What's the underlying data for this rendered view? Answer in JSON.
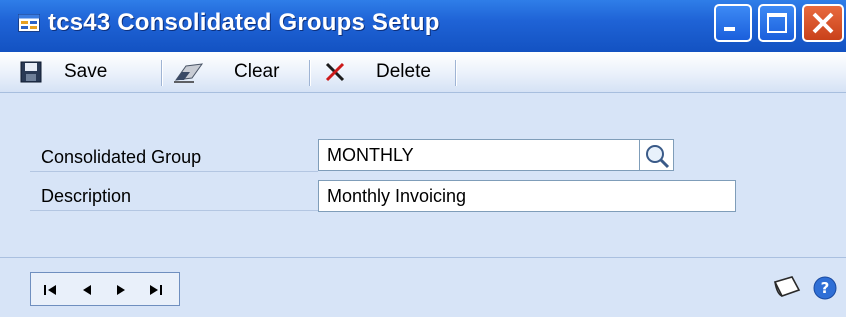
{
  "window": {
    "title": "tcs43 Consolidated Groups Setup",
    "icon": "form-window-icon",
    "controls": [
      "minimize-icon",
      "maximize-icon",
      "close-icon"
    ]
  },
  "toolbar": {
    "save_label": "Save",
    "clear_label": "Clear",
    "delete_label": "Delete"
  },
  "form": {
    "group_label": "Consolidated Group",
    "group_value": "MONTHLY",
    "description_label": "Description",
    "description_value": "Monthly Invoicing"
  },
  "footer": {
    "nav_buttons": [
      "first-record-icon",
      "previous-record-icon",
      "next-record-icon",
      "last-record-icon"
    ],
    "note_icon": "note-icon",
    "help_icon": "help-icon"
  },
  "colors": {
    "titlebar": "#1f63d6",
    "background": "#d7e4f7",
    "close_button": "#d04a20"
  }
}
